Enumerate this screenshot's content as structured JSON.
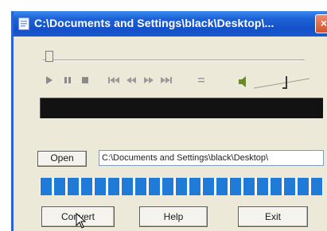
{
  "window": {
    "title": "C:\\Documents and Settings\\black\\Desktop\\...",
    "close_label": "×"
  },
  "transport": {
    "play_icon": "play-icon",
    "pause_icon": "pause-icon",
    "stop_icon": "stop-icon",
    "prev_icon": "skip-back-icon",
    "rewind_icon": "rewind-icon",
    "forward_icon": "fast-forward-icon",
    "next_icon": "skip-forward-icon",
    "repeat_icon": "repeat-icon",
    "volume_icon": "speaker-icon"
  },
  "file": {
    "open_label": "Open",
    "path_value": "C:\\Documents and Settings\\black\\Desktop\\"
  },
  "progress": {
    "fraction": 1.0,
    "color": "#1f7ad8"
  },
  "buttons": {
    "convert_label": "Convert",
    "help_label": "Help",
    "exit_label": "Exit"
  }
}
